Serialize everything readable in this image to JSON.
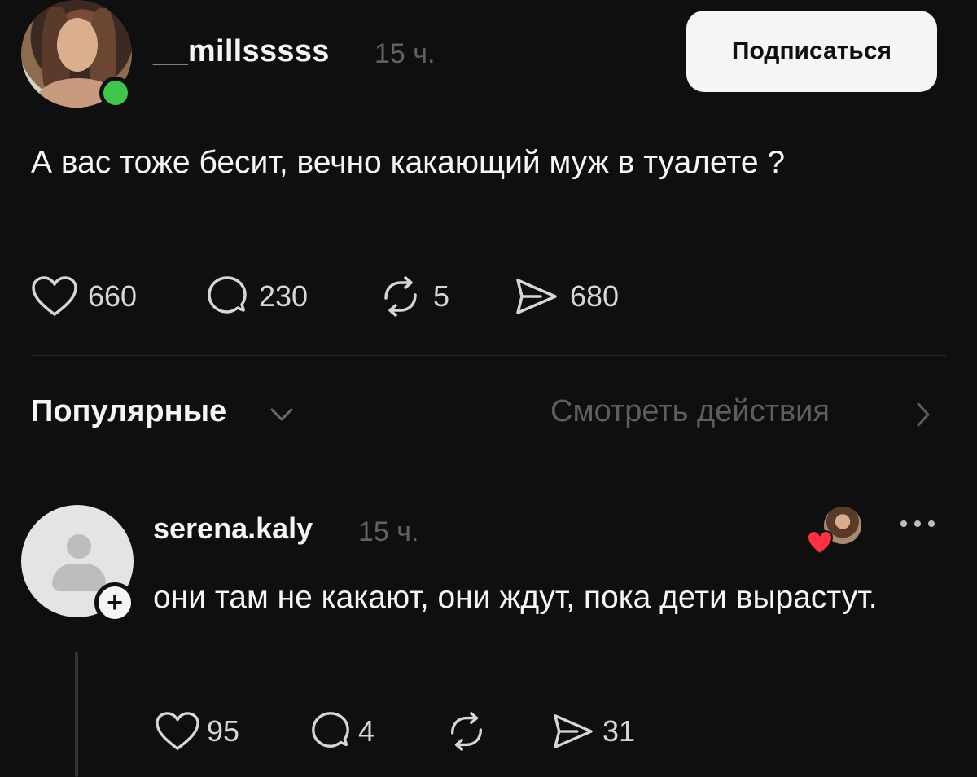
{
  "post": {
    "username": "__millsssss",
    "time": "15 ч.",
    "follow_label": "Подписаться",
    "text": "А вас тоже бесит, вечно какающий муж в туалете ?",
    "likes": "660",
    "comments": "230",
    "reposts": "5",
    "shares": "680"
  },
  "replies_header": {
    "sort_label": "Популярные",
    "activity_label": "Смотреть действия"
  },
  "reply": {
    "username": "serena.kaly",
    "time": "15 ч.",
    "text": "они там не какают, они ждут, пока дети вырастут.",
    "likes": "95",
    "comments": "4",
    "shares": "31"
  },
  "colors": {
    "background": "#0f0f0f",
    "text": "#f3f5f7",
    "muted": "#616161",
    "online": "#3ec64b",
    "heart": "#ff3040"
  }
}
